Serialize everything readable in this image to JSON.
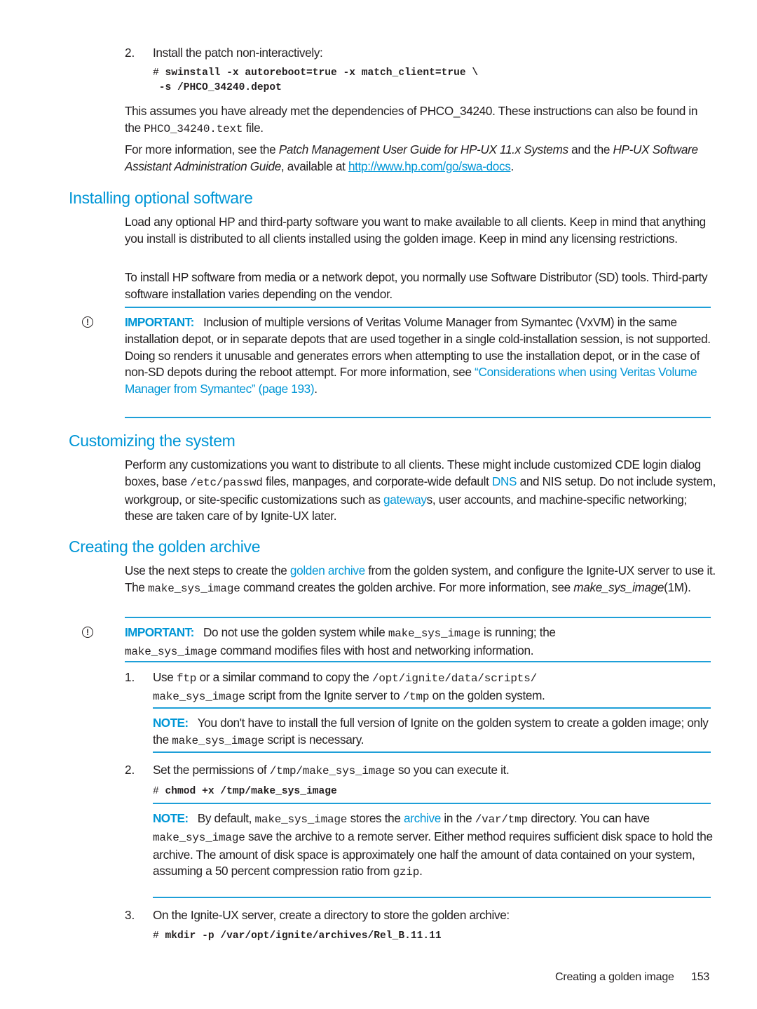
{
  "top": {
    "step2_num": "2.",
    "step2_text": "Install the patch non-interactively:",
    "cmd_line1_hash": "#",
    "cmd_line1": " swinstall -x autoreboot=true -x match_client=true \\",
    "cmd_line2": " -s /PHCO_34240.depot",
    "para1_a": "This assumes you have already met the dependencies of PHCO_34240. These instructions can also be found in the ",
    "para1_code": "PHCO_34240.text",
    "para1_b": " file.",
    "para2_a": "For more information, see the ",
    "para2_em1": "Patch Management User Guide for HP-UX 11.x Systems",
    "para2_b": " and the ",
    "para2_em2": "HP-UX Software Assistant Administration Guide",
    "para2_c": ", available at ",
    "para2_link": "http://www.hp.com/go/swa-docs",
    "para2_d": "."
  },
  "section_optional": {
    "heading": "Installing optional software",
    "para1": "Load any optional HP and third-party software you want to make available to all clients. Keep in mind that anything you install is distributed to all clients installed using the golden image. Keep in mind any licensing restrictions.",
    "para2": "To install HP software from media or a network depot, you normally use Software Distributor (SD) tools. Third-party software installation varies depending on the vendor.",
    "important_label": "IMPORTANT:",
    "important_text": "Inclusion of multiple versions of Veritas Volume Manager from Symantec (VxVM) in the same installation depot, or in separate depots that are used together in a single cold-installation session, is not supported. Doing so renders it unusable and generates errors when attempting to use the installation depot, or in the case of non-SD depots during the reboot attempt. For more information, see ",
    "important_link": "“Considerations when using Veritas Volume Manager from Symantec” (page 193)",
    "important_end": "."
  },
  "section_customizing": {
    "heading": "Customizing the system",
    "text_a": "Perform any customizations you want to distribute to all clients. These might include customized CDE login dialog boxes, base ",
    "code_passwd": "/etc/passwd",
    "text_b": " files, manpages, and corporate-wide default ",
    "link_dns": "DNS",
    "text_c": " and NIS setup. Do not include system, workgroup, or site-specific customizations such as ",
    "link_gateway": "gateway",
    "text_d": "s, user accounts, and machine-specific networking; these are taken care of by Ignite-UX later."
  },
  "section_archive": {
    "heading": "Creating the golden archive",
    "intro_a": "Use the next steps to create the ",
    "intro_link": "golden archive",
    "intro_b": " from the golden system, and configure the Ignite-UX server to use it. The ",
    "intro_code": "make_sys_image",
    "intro_c": " command creates the golden archive. For more information, see ",
    "intro_em": "make_sys_image",
    "intro_d": "(1M).",
    "important_label": "IMPORTANT:",
    "important_a": "Do not use the golden system while ",
    "important_code1": "make_sys_image",
    "important_b": " is running; the ",
    "important_code2": "make_sys_image",
    "important_c": " command modifies files with host and networking information.",
    "steps": [
      {
        "num": "1.",
        "a": "Use ",
        "code1": "ftp",
        "b": " or a similar command to copy the ",
        "code2": "/opt/ignite/data/scripts/",
        "code3": "make_sys_image",
        "c": " script from the Ignite server to ",
        "code4": "/tmp",
        "d": " on the golden system.",
        "note_label": "NOTE:",
        "note_a": "You don't have to install the full version of Ignite on the golden system to create a golden image; only the ",
        "note_code": "make_sys_image",
        "note_b": " script is necessary."
      },
      {
        "num": "2.",
        "a": "Set the permissions of ",
        "code1": "/tmp/make_sys_image",
        "b": " so you can execute it.",
        "cmd_hash": "#",
        "cmd": " chmod +x /tmp/make_sys_image",
        "note_label": "NOTE:",
        "note_a": "By default, ",
        "note_code1": "make_sys_image",
        "note_b": " stores the ",
        "note_link": "archive",
        "note_c": " in the ",
        "note_code2": "/var/tmp",
        "note_d": " directory. You can have ",
        "note_code3": "make_sys_image",
        "note_e": " save the archive to a remote server. Either method requires sufficient disk space to hold the archive. The amount of disk space is approximately one half the amount of data contained on your system, assuming a 50 percent compression ratio from ",
        "note_code4": "gzip",
        "note_f": "."
      },
      {
        "num": "3.",
        "a": "On the Ignite-UX server, create a directory to store the golden archive:",
        "cmd_hash": "#",
        "cmd": " mkdir -p /var/opt/ignite/archives/Rel_B.11.11"
      }
    ]
  },
  "footer": {
    "section": "Creating a golden image",
    "page": "153"
  },
  "icons": {
    "important": "important-exclamation-circle-icon"
  },
  "colors": {
    "accent": "#0096d6",
    "text": "#231f20"
  }
}
